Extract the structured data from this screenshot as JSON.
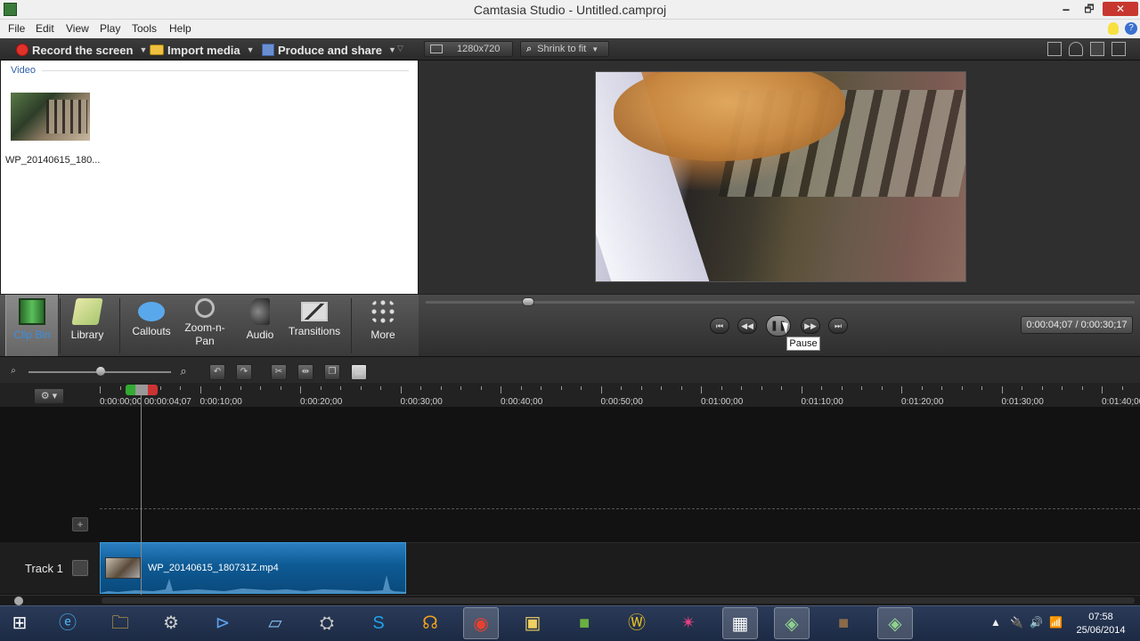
{
  "window": {
    "title": "Camtasia Studio - Untitled.camproj",
    "minimize": "🗕",
    "restore": "🗗",
    "close": "✕"
  },
  "menu": [
    "File",
    "Edit",
    "View",
    "Play",
    "Tools",
    "Help"
  ],
  "toolbar": {
    "record": "Record the screen",
    "import": "Import media",
    "produce": "Produce and share"
  },
  "preview_bar": {
    "dimensions": "1280x720",
    "zoom": "Shrink to fit"
  },
  "clip_bin": {
    "section": "Video",
    "items": [
      {
        "name": "WP_20140615_180..."
      }
    ]
  },
  "tabs": [
    {
      "label": "Clip Bin",
      "icon": "film-strip-icon",
      "selected": true
    },
    {
      "label": "Library",
      "icon": "library-icon"
    },
    {
      "label": "Callouts",
      "icon": "speech-bubble-icon"
    },
    {
      "label": "Zoom-n-\nPan",
      "icon": "magnifier-icon"
    },
    {
      "label": "Audio",
      "icon": "speaker-icon"
    },
    {
      "label": "Transitions",
      "icon": "transitions-icon"
    },
    {
      "label": "More",
      "icon": "more-dots-icon"
    }
  ],
  "playback": {
    "tooltip": "Pause",
    "timecode": "0:00:04;07 / 0:00:30;17",
    "scrub_fraction": 0.138
  },
  "ruler": {
    "playhead_label": "00:00:04;07",
    "labels": [
      "0:00:00;00",
      "0:00:10;00",
      "0:00:20;00",
      "0:00:30;00",
      "0:00:40;00",
      "0:00:50;00",
      "0:01:00;00",
      "0:01:10;00",
      "0:01:20;00",
      "0:01:30;00",
      "0:01:40;00"
    ]
  },
  "tracks": [
    {
      "label": "Track 1",
      "clip": "WP_20140615_180731Z.mp4"
    }
  ],
  "taskbar": {
    "time": "07:58",
    "date": "25/06/2014",
    "apps": [
      "start-icon",
      "ie-icon",
      "explorer-icon",
      "steam-icon",
      "visual-studio-icon",
      "notepad-icon",
      "game-icon",
      "skype-icon",
      "headphones-icon",
      "chrome-icon",
      "app-icon",
      "minecraft-icon",
      "wow-icon",
      "atom-icon",
      "camtasia-recorder-icon",
      "camtasia-studio-icon",
      "minecraft-2-icon",
      "camtasia-3-icon"
    ]
  },
  "colors": {
    "accent_blue": "#3a8fe0",
    "clip_blue": "#0d5a94",
    "record_red": "#e0322a"
  }
}
